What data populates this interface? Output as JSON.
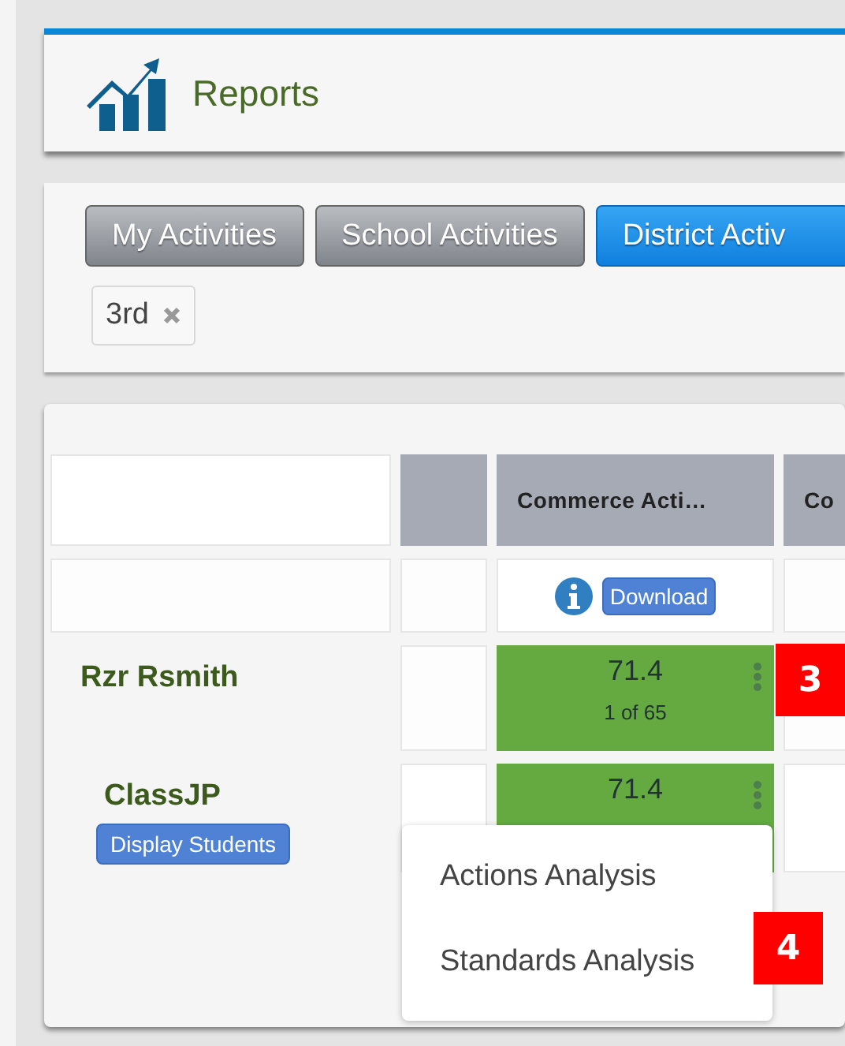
{
  "header": {
    "title": "Reports"
  },
  "filters": {
    "buttons": [
      {
        "label": "My Activities",
        "selected": false
      },
      {
        "label": "School Activities",
        "selected": false
      },
      {
        "label": "District Activ",
        "selected": true
      }
    ],
    "tags": [
      {
        "label": "3rd"
      }
    ]
  },
  "table": {
    "columns": [
      "Commerce Acti…",
      "Co"
    ],
    "download": "Download",
    "rows": [
      {
        "name": "Rzr Rsmith",
        "score": "71.4",
        "rank": "1 of 65"
      },
      {
        "name": "ClassJP",
        "score": "71.4",
        "button": "Display Students"
      }
    ]
  },
  "menu": {
    "items": [
      "Actions Analysis",
      "Standards Analysis"
    ]
  },
  "callouts": [
    "3",
    "4"
  ]
}
